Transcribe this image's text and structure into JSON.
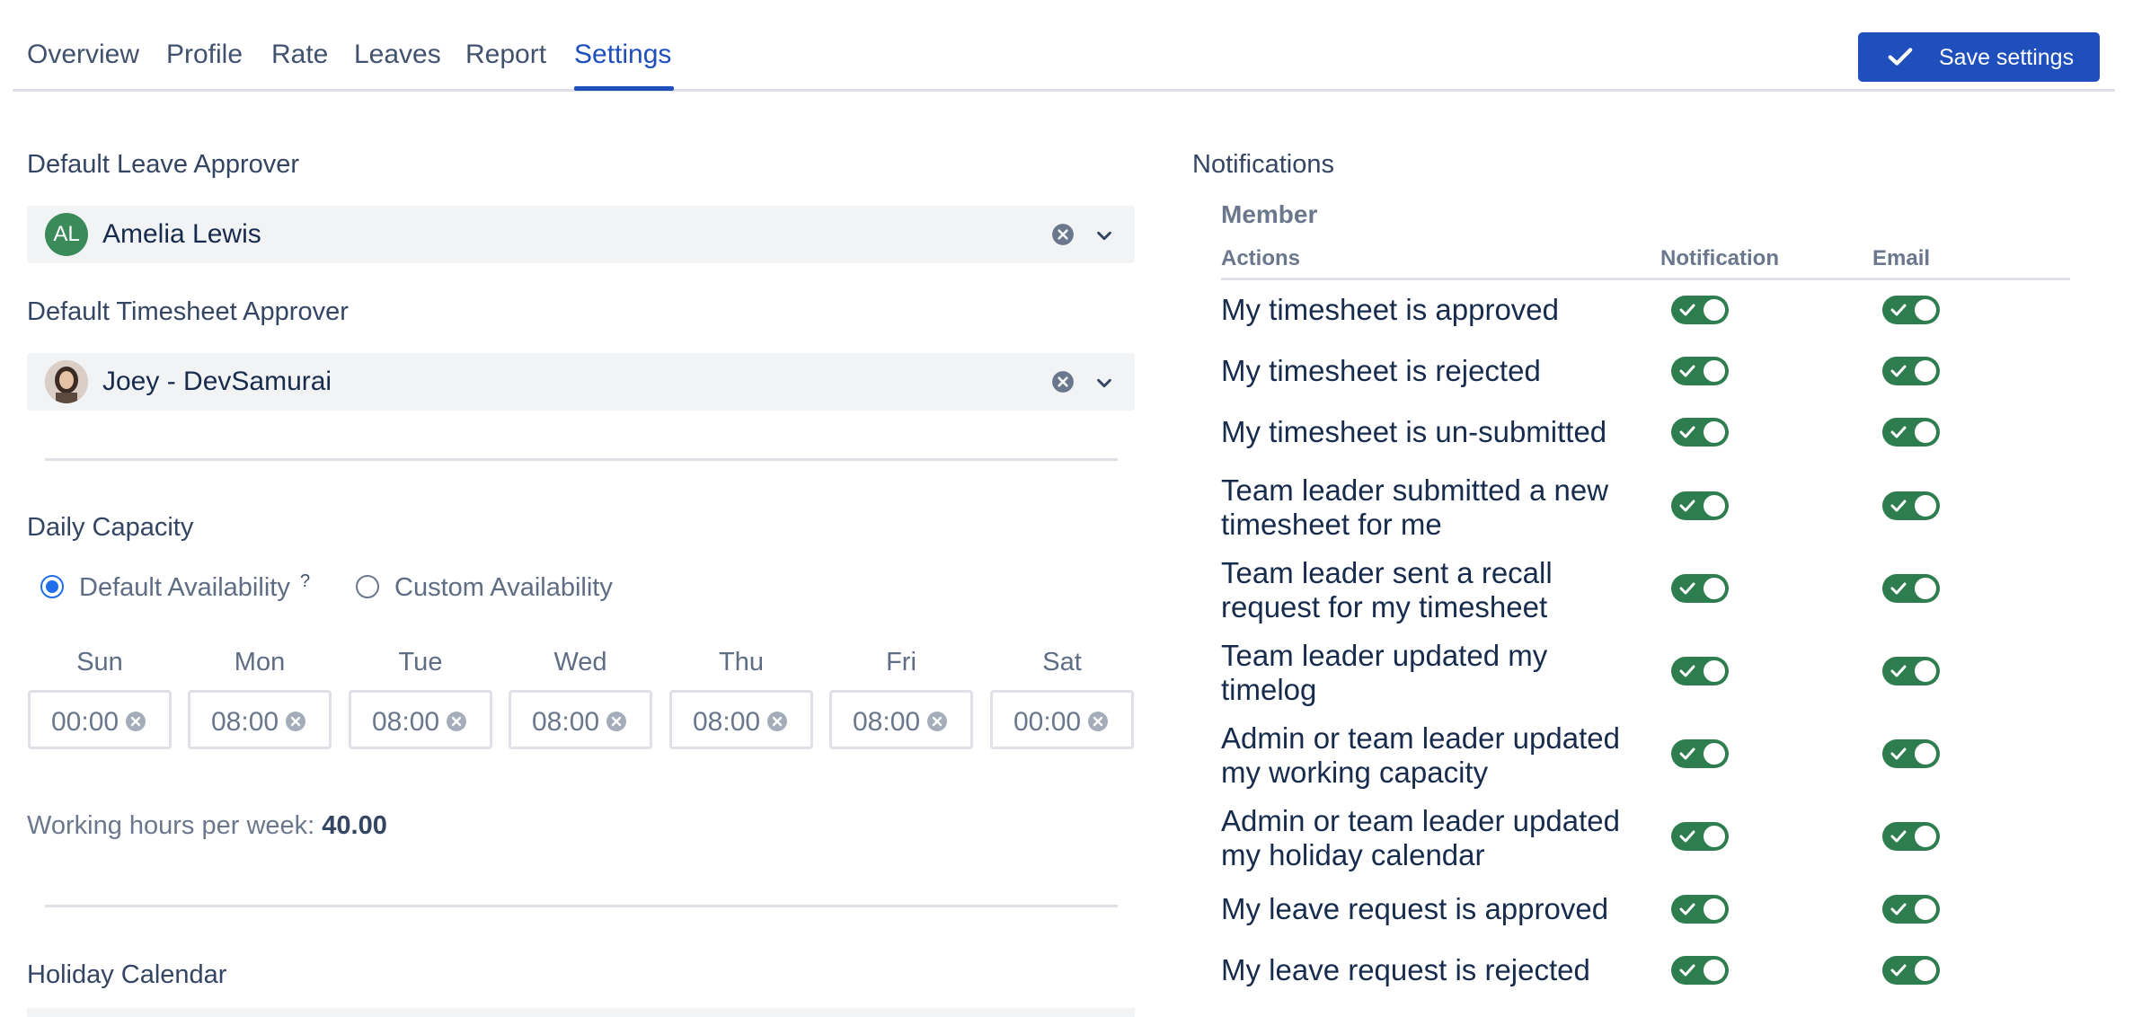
{
  "tabs": [
    {
      "label": "Overview",
      "active": false
    },
    {
      "label": "Profile",
      "active": false
    },
    {
      "label": "Rate",
      "active": false
    },
    {
      "label": "Leaves",
      "active": false
    },
    {
      "label": "Report",
      "active": false
    },
    {
      "label": "Settings",
      "active": true
    }
  ],
  "toolbar": {
    "save_label": "Save settings",
    "accent_color": "#1f4ebd"
  },
  "leave_approver": {
    "title": "Default Leave Approver",
    "initials": "AL",
    "name": "Amelia Lewis"
  },
  "timesheet_approver": {
    "title": "Default Timesheet Approver",
    "name": "Joey - DevSamurai"
  },
  "capacity": {
    "title": "Daily Capacity",
    "options": [
      {
        "label": "Default Availability",
        "selected": true,
        "help": "?"
      },
      {
        "label": "Custom Availability",
        "selected": false
      }
    ],
    "days": [
      {
        "name": "Sun",
        "value": "00:00"
      },
      {
        "name": "Mon",
        "value": "08:00"
      },
      {
        "name": "Tue",
        "value": "08:00"
      },
      {
        "name": "Wed",
        "value": "08:00"
      },
      {
        "name": "Thu",
        "value": "08:00"
      },
      {
        "name": "Fri",
        "value": "08:00"
      },
      {
        "name": "Sat",
        "value": "00:00"
      }
    ],
    "week_label": "Working hours per week:",
    "week_value": "40.00"
  },
  "holiday": {
    "title": "Holiday Calendar"
  },
  "notifications": {
    "title": "Notifications",
    "group": "Member",
    "columns": {
      "actions": "Actions",
      "notification": "Notification",
      "email": "Email"
    },
    "toggle_color": "#2e7d4f",
    "rows": [
      {
        "label": "My timesheet is approved",
        "notification": true,
        "email": true
      },
      {
        "label": "My timesheet is rejected",
        "notification": true,
        "email": true
      },
      {
        "label": "My timesheet is un-submitted",
        "notification": true,
        "email": true
      },
      {
        "label": "Team leader submitted a new timesheet for me",
        "notification": true,
        "email": true
      },
      {
        "label": "Team leader sent a recall request for my timesheet",
        "notification": true,
        "email": true
      },
      {
        "label": "Team leader updated my timelog",
        "notification": true,
        "email": true
      },
      {
        "label": "Admin or team leader updated my working capacity",
        "notification": true,
        "email": true
      },
      {
        "label": "Admin or team leader updated my holiday calendar",
        "notification": true,
        "email": true
      },
      {
        "label": "My leave request is approved",
        "notification": true,
        "email": true
      },
      {
        "label": "My leave request is rejected",
        "notification": true,
        "email": true
      }
    ]
  }
}
